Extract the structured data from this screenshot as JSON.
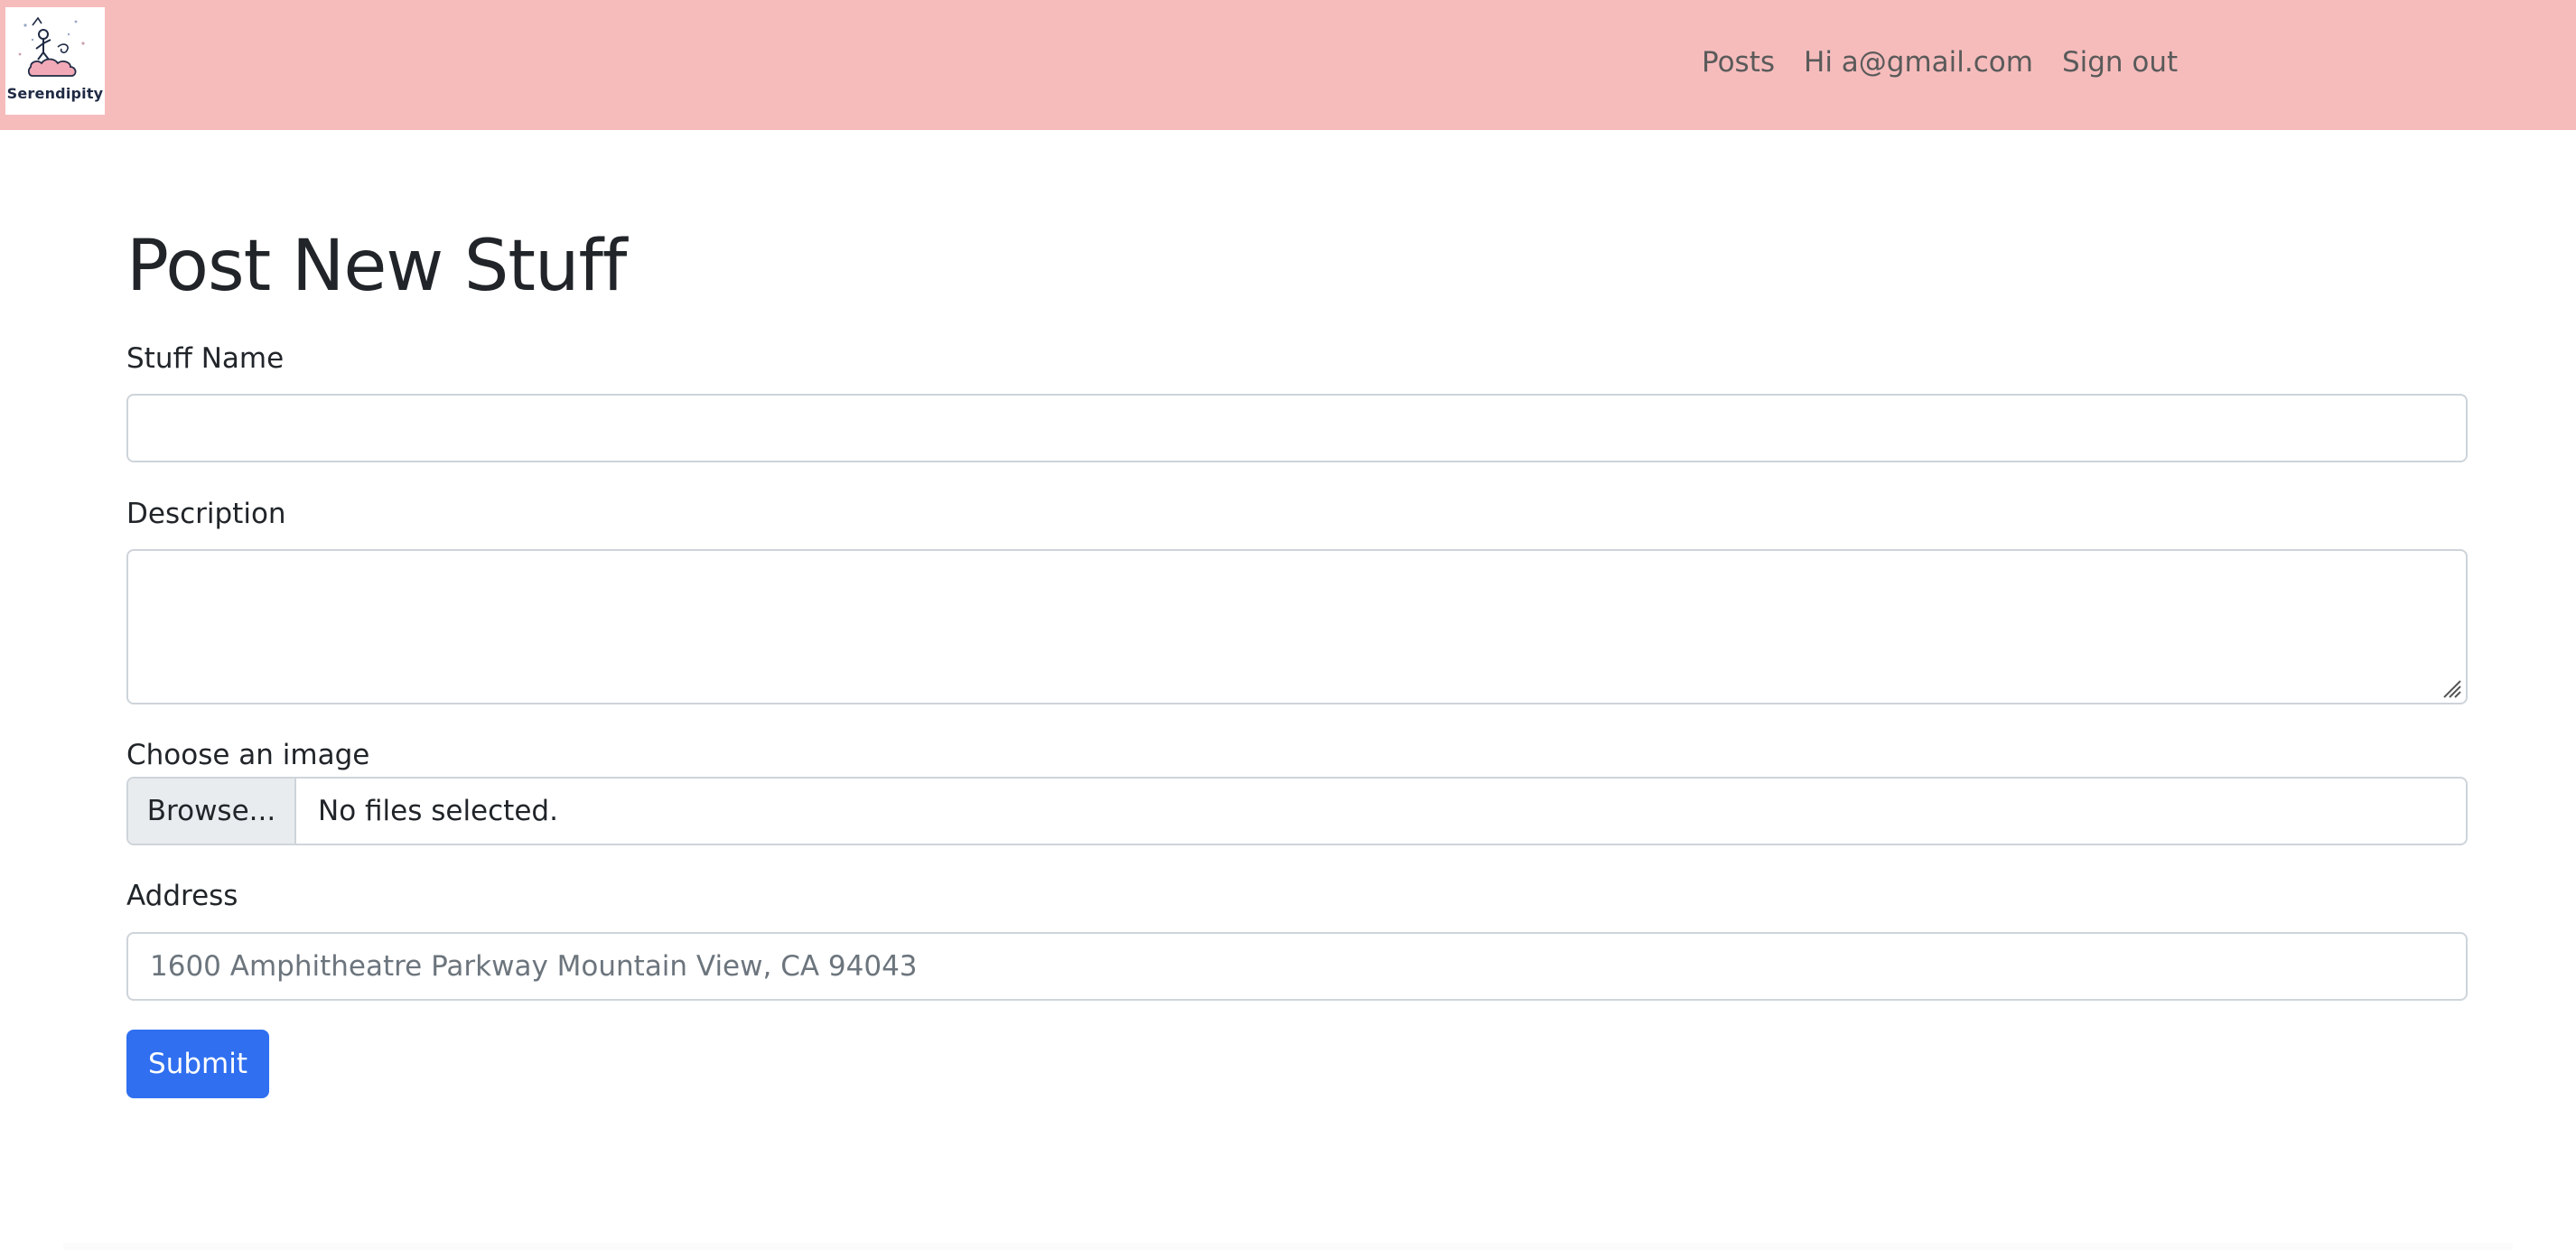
{
  "brand": {
    "logo_text": "Serendipity",
    "accent_color": "#f6bcbc"
  },
  "nav": {
    "items": [
      {
        "label": "Posts"
      },
      {
        "label": "Hi a@gmail.com"
      },
      {
        "label": "Sign out"
      }
    ]
  },
  "page": {
    "title": "Post New Stuff"
  },
  "form": {
    "stuff_name": {
      "label": "Stuff Name",
      "value": "",
      "placeholder": ""
    },
    "description": {
      "label": "Description",
      "value": ""
    },
    "image": {
      "label": "Choose an image",
      "button_label": "Browse...",
      "status": "No files selected."
    },
    "address": {
      "label": "Address",
      "value": "",
      "placeholder": "1600 Amphitheatre Parkway Mountain View, CA 94043"
    },
    "submit_label": "Submit",
    "submit_color": "#2f6ff0"
  }
}
